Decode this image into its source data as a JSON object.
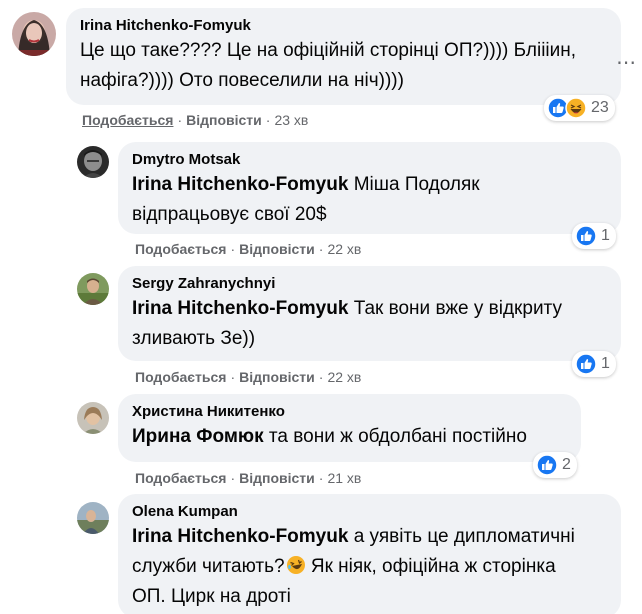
{
  "top_partial_text": "",
  "comments": [
    {
      "author": "Irina Hitchenko-Fomyuk",
      "mention": "",
      "text_line1": "Це що таке???? Це на офіційній сторінці ОП?)))) Бліііин,",
      "text_line2": "нафіга?)))) Ото повеселили на ніч))))",
      "like_label": "Подобається",
      "reply_label": "Відповісти",
      "time": "23 хв",
      "reaction_count": "23",
      "reactions": [
        "like-icon",
        "haha-icon"
      ]
    },
    {
      "author": "Dmytro Motsak",
      "mention": "Irina Hitchenko-Fomyuk",
      "text_line1": " Міша Подоляк",
      "text_line2": "відпрацьовує свої 20$",
      "like_label": "Подобається",
      "reply_label": "Відповісти",
      "time": "22 хв",
      "reaction_count": "1",
      "reactions": [
        "like-icon"
      ]
    },
    {
      "author": "Sergy Zahranychnyi",
      "mention": "Irina Hitchenko-Fomyuk",
      "text_line1": " Так вони вже у відкриту",
      "text_line2": "зливають Зе))",
      "like_label": "Подобається",
      "reply_label": "Відповісти",
      "time": "22 хв",
      "reaction_count": "1",
      "reactions": [
        "like-icon"
      ]
    },
    {
      "author": "Христина Никитенко",
      "mention": "Ирина Фомюк",
      "text_line1": " та вони ж обдолбані постійно",
      "text_line2": "",
      "like_label": "Подобається",
      "reply_label": "Відповісти",
      "time": "21 хв",
      "reaction_count": "2",
      "reactions": [
        "like-icon"
      ]
    },
    {
      "author": "Olena Kumpan",
      "mention": "Irina Hitchenko-Fomyuk",
      "text_line1": " а уявіть це дипломатичні",
      "text_line2a": "служби читають?",
      "text_line2b": " Як ніяк, офіційна ж сторінка",
      "text_line3": "ОП. Цирк на дроті",
      "inline_emoji": "rofl-emoji-icon"
    }
  ],
  "colors": {
    "bubble": "#f0f2f5",
    "meta": "#65676b",
    "like_blue": "#1877f2",
    "haha_yellow": "#f7b125"
  }
}
